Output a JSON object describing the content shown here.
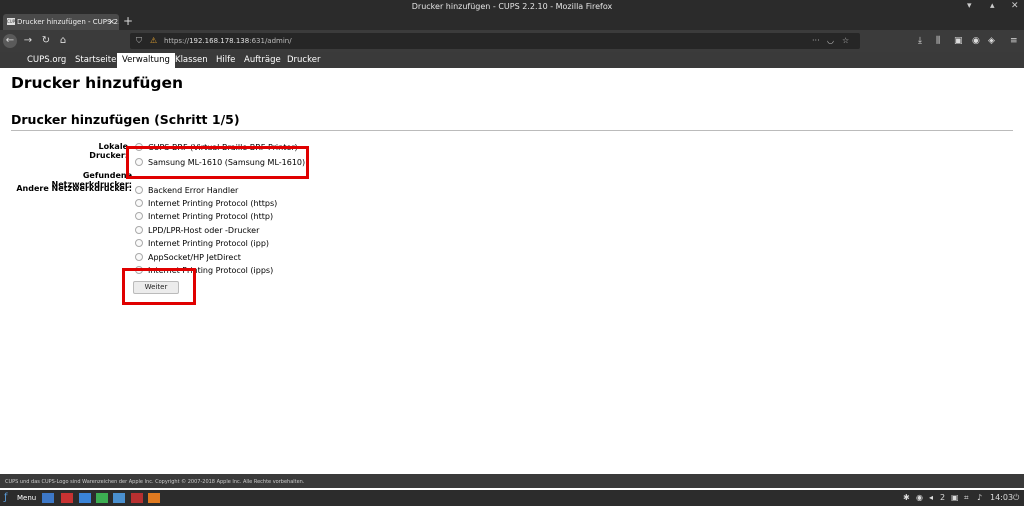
{
  "window": {
    "title": "Drucker hinzufügen - CUPS 2.2.10 - Mozilla Firefox"
  },
  "tab": {
    "label": "Drucker hinzufügen - CUPS 2.",
    "favicon": "CUPS"
  },
  "url": {
    "prefix": "https://",
    "host": "192.168.178.138",
    "path": ":631/admin/"
  },
  "menu": {
    "items": [
      "CUPS.org",
      "Startseite",
      "Verwaltung",
      "Klassen",
      "Hilfe",
      "Aufträge",
      "Drucker"
    ],
    "active": "Verwaltung"
  },
  "page": {
    "heading": "Drucker hinzufügen",
    "subheading": "Drucker hinzufügen (Schritt 1/5)",
    "labels": {
      "local": "Lokale Drucker:",
      "found": "Gefundene Netzwerkdrucker:",
      "other": "Andere Netzwerkdrucker:"
    },
    "local_printers": [
      "CUPS-BRF (Virtual Braille BRF Printer)",
      "Samsung ML-1610 (Samsung ML-1610)"
    ],
    "other_printers": [
      "Backend Error Handler",
      "Internet Printing Protocol (https)",
      "Internet Printing Protocol (http)",
      "LPD/LPR-Host oder -Drucker",
      "Internet Printing Protocol (ipp)",
      "AppSocket/HP JetDirect",
      "Internet Printing Protocol (ipps)"
    ],
    "continue_button": "Weiter"
  },
  "footer": {
    "text": "CUPS und das CUPS-Logo sind Warenzeichen der Apple Inc. Copyright © 2007-2018 Apple Inc. Alle Rechte vorbehalten."
  },
  "taskbar": {
    "menu_label": "Menu",
    "workspace": "2",
    "clock": "14:03"
  },
  "colors": {
    "highlight": "#e00000"
  }
}
